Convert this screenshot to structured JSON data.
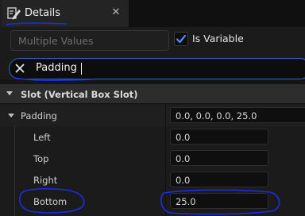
{
  "tab": {
    "title": "Details",
    "close_label": "✕"
  },
  "header": {
    "name_field_value": "Multiple Values",
    "is_variable_label": "Is Variable",
    "is_variable_checked": true
  },
  "search": {
    "value": "Padding"
  },
  "category": {
    "title": "Slot (Vertical Box Slot)"
  },
  "padding": {
    "label": "Padding",
    "value": "0.0, 0.0, 0.0, 25.0",
    "fields": [
      {
        "label": "Left",
        "value": "0.0"
      },
      {
        "label": "Top",
        "value": "0.0"
      },
      {
        "label": "Right",
        "value": "0.0"
      },
      {
        "label": "Bottom",
        "value": "25.0"
      }
    ]
  },
  "colors": {
    "accent_blue": "#2f66cc",
    "annotation_blue": "#1a2ee6",
    "checkbox_tick": "#4a8cff"
  },
  "icons": {
    "tab": "details-pencil-icon",
    "close": "close-icon",
    "search_clear": "clear-search-icon",
    "expand": "chevron-down-icon"
  }
}
